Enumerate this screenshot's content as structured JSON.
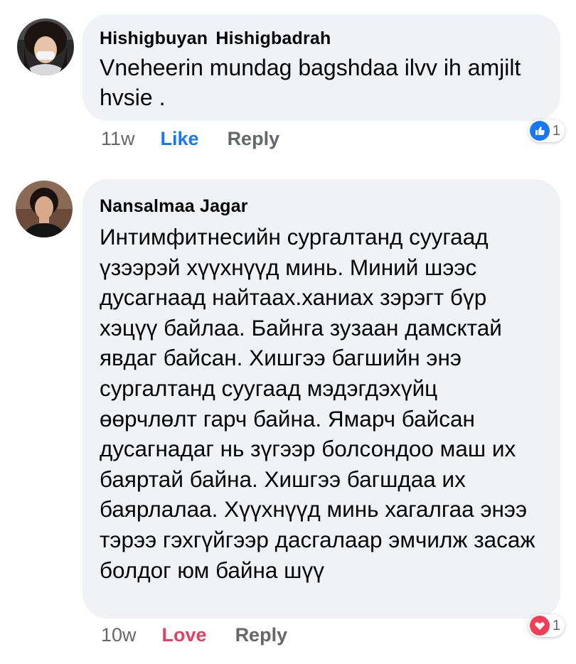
{
  "comments": [
    {
      "author": "Hishigbuyan  Hishigbadrah",
      "text": "Vneheerin mundag bagshdaa ilvv ih amjilt hvsie .",
      "time": "11w",
      "reaction_action": "Like",
      "reply": "Reply",
      "reaction_icon": "like-icon",
      "reaction_count": "1"
    },
    {
      "author": "Nansalmaa Jagar",
      "text": "Интимфитнесийн сургалтанд суугаад үзээрэй хүүхнүүд минь. Миний шээс дусагнаад найтаах.ханиах зэрэгт бүр хэцүү байлаа. Байнга зузаан дамсктай явдаг байсан. Хишгээ багшийн энэ сургалтанд суугаад мэдэгдэхүйц өөрчлөлт гарч байна. Ямарч байсан дусагнадаг нь зүгээр болсондоо маш их баяртай байна. Хишгээ багшдаа их баярлалаа. Хүүхнүүд минь хагалгаа энээ тэрээ гэхгүйгээр дасгалаар эмчилж засаж болдог юм байна шүү",
      "time": "10w",
      "reaction_action": "Love",
      "reply": "Reply",
      "reaction_icon": "love-icon",
      "reaction_count": "1"
    }
  ],
  "colors": {
    "bubble": "#f0f2f5",
    "like": "#1877f2",
    "love": "#e4405f",
    "meta": "#65676b"
  }
}
